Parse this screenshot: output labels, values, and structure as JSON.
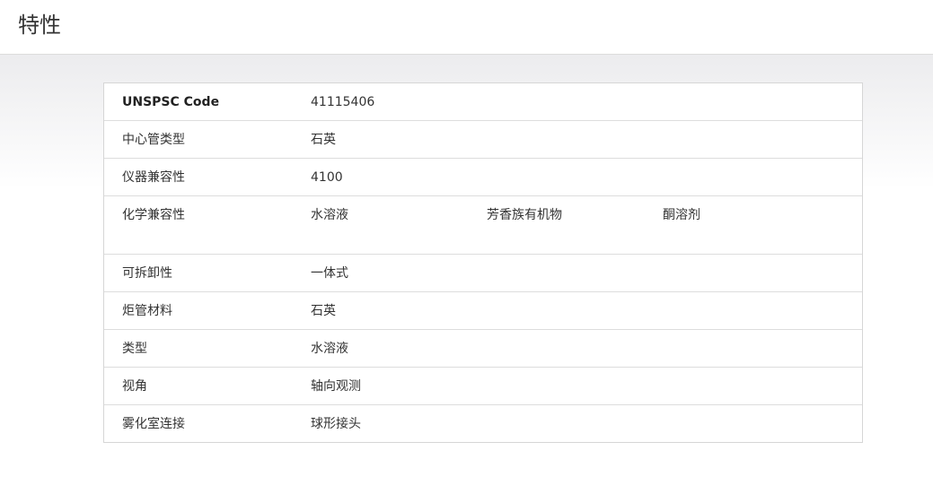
{
  "header": {
    "title": "特性"
  },
  "specs": [
    {
      "label": "UNSPSC Code",
      "values": [
        "41115406"
      ]
    },
    {
      "label": "中心管类型",
      "values": [
        "石英"
      ]
    },
    {
      "label": "仪器兼容性",
      "values": [
        "4100"
      ]
    },
    {
      "label": "化学兼容性",
      "values": [
        "水溶液",
        "芳香族有机物",
        "酮溶剂"
      ]
    },
    {
      "label": "可拆卸性",
      "values": [
        "一体式"
      ]
    },
    {
      "label": "炬管材料",
      "values": [
        "石英"
      ]
    },
    {
      "label": "类型",
      "values": [
        "水溶液"
      ]
    },
    {
      "label": "视角",
      "values": [
        "轴向观测"
      ]
    },
    {
      "label": "雾化室连接",
      "values": [
        "球形接头"
      ]
    }
  ]
}
